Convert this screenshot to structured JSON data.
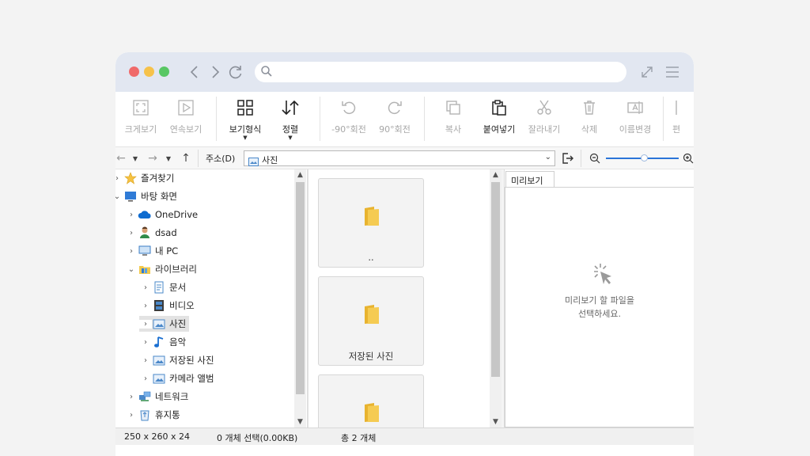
{
  "ribbon": {
    "fullscreen_label": "크게보기",
    "slideshow_label": "연속보기",
    "view_mode_label": "보기형식",
    "sort_label": "정렬",
    "rotate_left_label": "-90°회전",
    "rotate_right_label": "90°회전",
    "copy_label": "복사",
    "paste_label": "붙여넣기",
    "cut_label": "잘라내기",
    "delete_label": "삭제",
    "rename_label": "이름변경",
    "edit_label_partial": "편"
  },
  "address": {
    "label": "주소(D)",
    "path": "사진"
  },
  "tree": {
    "items": [
      {
        "label": "즐겨찾기"
      },
      {
        "label": "바탕 화면"
      },
      {
        "label": "OneDrive"
      },
      {
        "label": "dsad"
      },
      {
        "label": "내 PC"
      },
      {
        "label": "라이브러리"
      },
      {
        "label": "문서"
      },
      {
        "label": "비디오"
      },
      {
        "label": "사진"
      },
      {
        "label": "음악"
      },
      {
        "label": "저장된 사진"
      },
      {
        "label": "카메라 앨범"
      },
      {
        "label": "네트워크"
      },
      {
        "label": "휴지통"
      }
    ]
  },
  "files": {
    "tiles": [
      {
        "name": ".."
      },
      {
        "name": "저장된 사진"
      },
      {
        "name": ""
      }
    ]
  },
  "preview": {
    "tab_label": "미리보기",
    "message_line1": "미리보기 할 파일을",
    "message_line2": "선택하세요."
  },
  "status": {
    "dimensions": "250 x 260 x 24",
    "selection": "0 개체 선택(0.00KB)",
    "total": "총 2 개체"
  },
  "colors": {
    "titlebar": "#e2e7f1",
    "close": "#f06a6a",
    "minimize": "#f6c24a",
    "maximize": "#58c764",
    "accent": "#2b74d8",
    "folder": "#f3c94b"
  }
}
